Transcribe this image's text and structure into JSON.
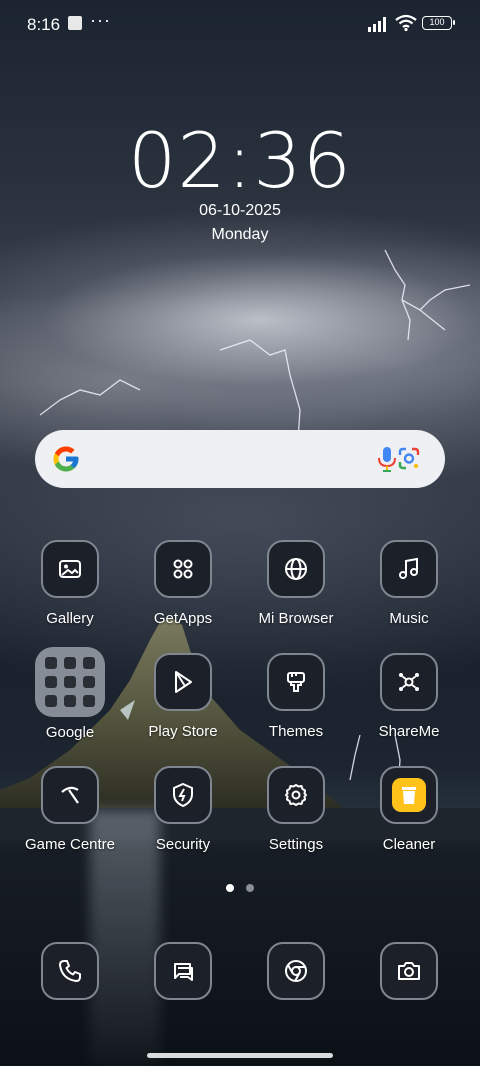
{
  "status_bar": {
    "time": "8:16",
    "more_dots": "···",
    "battery": "100"
  },
  "clock": {
    "time": "02:36",
    "date": "06-10-2025",
    "day": "Monday"
  },
  "search_bar": {
    "icons": [
      "google-logo-icon",
      "microphone-icon",
      "google-lens-icon"
    ]
  },
  "apps": {
    "gallery": "Gallery",
    "getapps": "GetApps",
    "mi_browser": "Mi Browser",
    "music": "Music",
    "google": "Google",
    "play_store": "Play Store",
    "themes": "Themes",
    "shareme": "ShareMe",
    "game_centre": "Game Centre",
    "security": "Security",
    "settings": "Settings",
    "cleaner": "Cleaner"
  },
  "dock": {
    "icons": [
      "phone-icon",
      "messaging-icon",
      "chrome-icon",
      "camera-icon"
    ]
  },
  "page_indicator": {
    "pages": 2,
    "current": 1
  },
  "colors": {
    "icon_bg": "#1c2129",
    "icon_border": "#7f8690",
    "cleaner_accent": "#ffc21a",
    "search_bg": "#eef0f3"
  }
}
